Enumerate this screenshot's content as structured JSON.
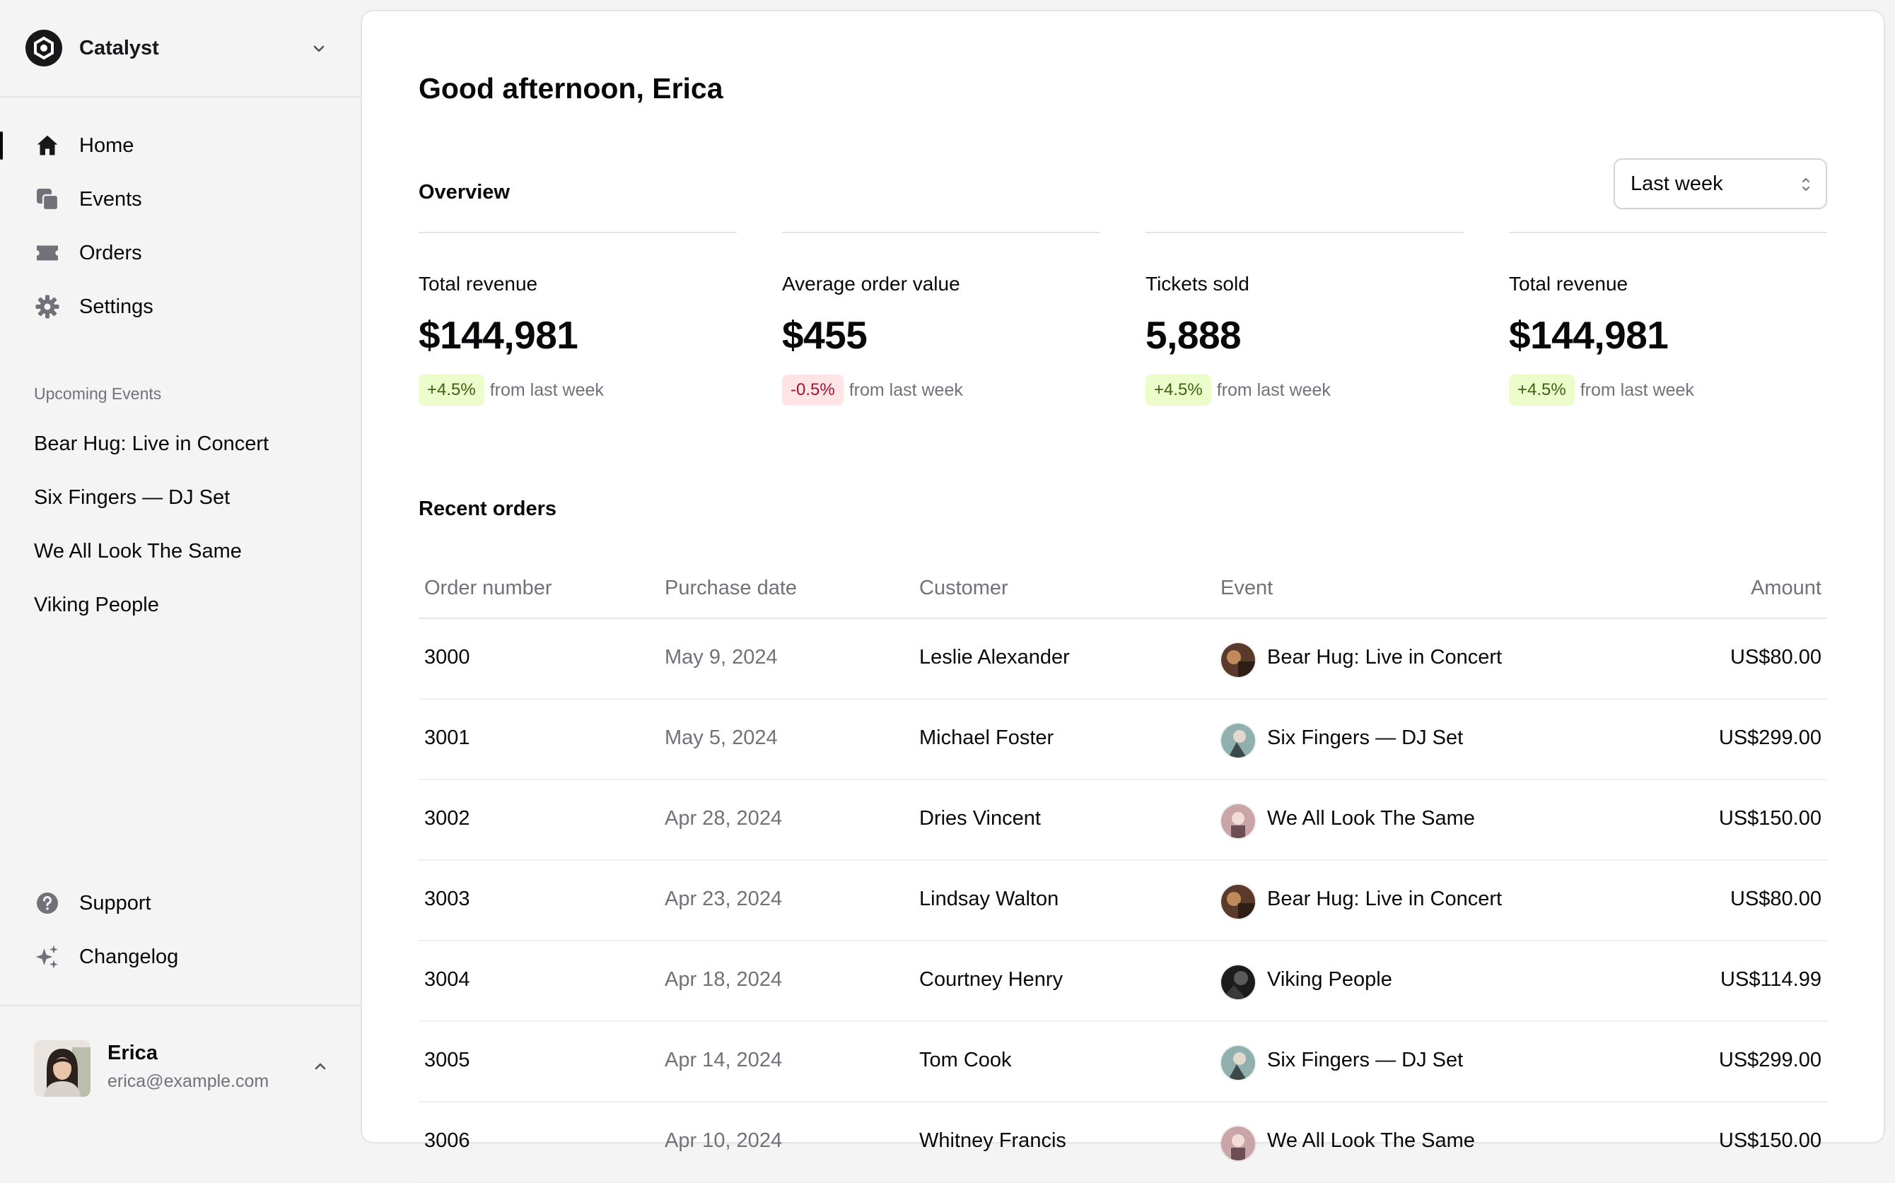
{
  "team": {
    "name": "Catalyst"
  },
  "nav": [
    {
      "label": "Home",
      "icon": "home-icon",
      "active": true
    },
    {
      "label": "Events",
      "icon": "events-icon"
    },
    {
      "label": "Orders",
      "icon": "ticket-icon"
    },
    {
      "label": "Settings",
      "icon": "gear-icon"
    }
  ],
  "upcoming": {
    "heading": "Upcoming Events",
    "events": [
      "Bear Hug: Live in Concert",
      "Six Fingers — DJ Set",
      "We All Look The Same",
      "Viking People"
    ]
  },
  "footer_nav": [
    {
      "label": "Support",
      "icon": "question-icon"
    },
    {
      "label": "Changelog",
      "icon": "sparkles-icon"
    }
  ],
  "user": {
    "name": "Erica",
    "email": "erica@example.com"
  },
  "greeting": "Good afternoon, Erica",
  "overview": {
    "title": "Overview",
    "period": "Last week",
    "stats": [
      {
        "label": "Total revenue",
        "value": "$144,981",
        "change": "+4.5%",
        "trend": "up",
        "suffix": "from last week"
      },
      {
        "label": "Average order value",
        "value": "$455",
        "change": "-0.5%",
        "trend": "down",
        "suffix": "from last week"
      },
      {
        "label": "Tickets sold",
        "value": "5,888",
        "change": "+4.5%",
        "trend": "up",
        "suffix": "from last week"
      },
      {
        "label": "Total revenue",
        "value": "$144,981",
        "change": "+4.5%",
        "trend": "up",
        "suffix": "from last week"
      }
    ]
  },
  "orders": {
    "title": "Recent orders",
    "columns": [
      "Order number",
      "Purchase date",
      "Customer",
      "Event",
      "Amount"
    ],
    "rows": [
      {
        "order": "3000",
        "date": "May 9, 2024",
        "customer": "Leslie Alexander",
        "event": "Bear Hug: Live in Concert",
        "amount": "US$80.00"
      },
      {
        "order": "3001",
        "date": "May 5, 2024",
        "customer": "Michael Foster",
        "event": "Six Fingers — DJ Set",
        "amount": "US$299.00"
      },
      {
        "order": "3002",
        "date": "Apr 28, 2024",
        "customer": "Dries Vincent",
        "event": "We All Look The Same",
        "amount": "US$150.00"
      },
      {
        "order": "3003",
        "date": "Apr 23, 2024",
        "customer": "Lindsay Walton",
        "event": "Bear Hug: Live in Concert",
        "amount": "US$80.00"
      },
      {
        "order": "3004",
        "date": "Apr 18, 2024",
        "customer": "Courtney Henry",
        "event": "Viking People",
        "amount": "US$114.99"
      },
      {
        "order": "3005",
        "date": "Apr 14, 2024",
        "customer": "Tom Cook",
        "event": "Six Fingers — DJ Set",
        "amount": "US$299.00"
      },
      {
        "order": "3006",
        "date": "Apr 10, 2024",
        "customer": "Whitney Francis",
        "event": "We All Look The Same",
        "amount": "US$150.00"
      }
    ]
  }
}
